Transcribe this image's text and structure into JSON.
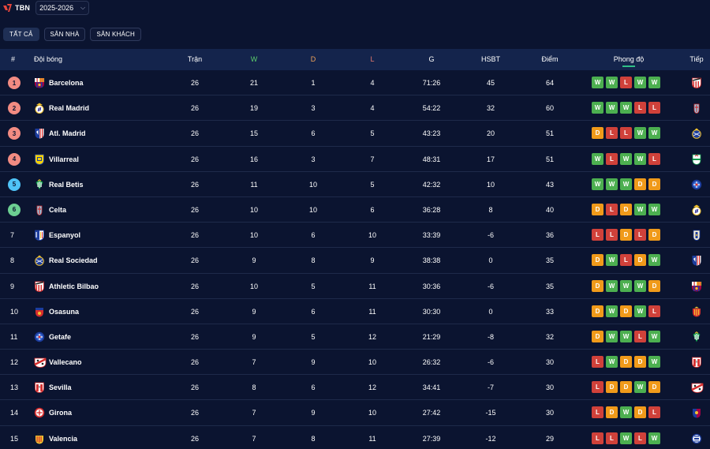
{
  "brand": {
    "logo_icon": "tbn-logo-icon",
    "name": "TBN",
    "color": "#e8463c"
  },
  "season": {
    "value": "2025-2026"
  },
  "filters": [
    {
      "label": "TẤT CẢ",
      "active": true
    },
    {
      "label": "SÂN NHÀ",
      "active": false
    },
    {
      "label": "SÂN KHÁCH",
      "active": false
    }
  ],
  "headers": {
    "rank": "#",
    "team": "Đội bóng",
    "played": "Trận",
    "won": "W",
    "drawn": "D",
    "lost": "L",
    "goals": "G",
    "goal_diff": "HSBT",
    "points": "Điểm",
    "form": "Phong độ",
    "next": "Tiếp"
  },
  "zone_colors": {
    "1": "#f28b82",
    "2": "#f28b82",
    "3": "#f28b82",
    "4": "#f28b82",
    "5": "#4fc3f7",
    "6": "#6ccf92"
  },
  "form_colors": {
    "W": "#4caf50",
    "D": "#f09a1a",
    "L": "#d0413a"
  },
  "rows": [
    {
      "rank": "1",
      "zone": "1",
      "team": "Barcelona",
      "crest": "barcelona-crest-icon",
      "played": "26",
      "won": "21",
      "drawn": "1",
      "lost": "4",
      "goals": "71:26",
      "goal_diff": "45",
      "points": "64",
      "form": [
        "W",
        "W",
        "L",
        "W",
        "W"
      ],
      "next": "athletic-bilbao-crest-icon"
    },
    {
      "rank": "2",
      "zone": "2",
      "team": "Real Madrid",
      "crest": "real-madrid-crest-icon",
      "played": "26",
      "won": "19",
      "drawn": "3",
      "lost": "4",
      "goals": "54:22",
      "goal_diff": "32",
      "points": "60",
      "form": [
        "W",
        "W",
        "W",
        "L",
        "L"
      ],
      "next": "celta-crest-icon"
    },
    {
      "rank": "3",
      "zone": "3",
      "team": "Atl. Madrid",
      "crest": "atletico-madrid-crest-icon",
      "played": "26",
      "won": "15",
      "drawn": "6",
      "lost": "5",
      "goals": "43:23",
      "goal_diff": "20",
      "points": "51",
      "form": [
        "D",
        "L",
        "L",
        "W",
        "W"
      ],
      "next": "real-sociedad-crest-icon"
    },
    {
      "rank": "4",
      "zone": "4",
      "team": "Villarreal",
      "crest": "villarreal-crest-icon",
      "played": "26",
      "won": "16",
      "drawn": "3",
      "lost": "7",
      "goals": "48:31",
      "goal_diff": "17",
      "points": "51",
      "form": [
        "W",
        "L",
        "W",
        "W",
        "L"
      ],
      "next": "elche-crest-icon"
    },
    {
      "rank": "5",
      "zone": "5",
      "team": "Real Betis",
      "crest": "real-betis-crest-icon",
      "played": "26",
      "won": "11",
      "drawn": "10",
      "lost": "5",
      "goals": "42:32",
      "goal_diff": "10",
      "points": "43",
      "form": [
        "W",
        "W",
        "W",
        "D",
        "D"
      ],
      "next": "getafe-crest-icon"
    },
    {
      "rank": "6",
      "zone": "6",
      "team": "Celta",
      "crest": "celta-crest-icon",
      "played": "26",
      "won": "10",
      "drawn": "10",
      "lost": "6",
      "goals": "36:28",
      "goal_diff": "8",
      "points": "40",
      "form": [
        "D",
        "L",
        "D",
        "W",
        "W"
      ],
      "next": "real-madrid-crest-icon"
    },
    {
      "rank": "7",
      "zone": "",
      "team": "Espanyol",
      "crest": "espanyol-crest-icon",
      "played": "26",
      "won": "10",
      "drawn": "6",
      "lost": "10",
      "goals": "33:39",
      "goal_diff": "-6",
      "points": "36",
      "form": [
        "L",
        "L",
        "D",
        "L",
        "D"
      ],
      "next": "oviedo-crest-icon"
    },
    {
      "rank": "8",
      "zone": "",
      "team": "Real Sociedad",
      "crest": "real-sociedad-crest-icon",
      "played": "26",
      "won": "9",
      "drawn": "8",
      "lost": "9",
      "goals": "38:38",
      "goal_diff": "0",
      "points": "35",
      "form": [
        "D",
        "W",
        "L",
        "D",
        "W"
      ],
      "next": "atletico-madrid-crest-icon"
    },
    {
      "rank": "9",
      "zone": "",
      "team": "Athletic Bilbao",
      "crest": "athletic-bilbao-crest-icon",
      "played": "26",
      "won": "10",
      "drawn": "5",
      "lost": "11",
      "goals": "30:36",
      "goal_diff": "-6",
      "points": "35",
      "form": [
        "D",
        "W",
        "W",
        "W",
        "D"
      ],
      "next": "barcelona-crest-icon"
    },
    {
      "rank": "10",
      "zone": "",
      "team": "Osasuna",
      "crest": "osasuna-crest-icon",
      "played": "26",
      "won": "9",
      "drawn": "6",
      "lost": "11",
      "goals": "30:30",
      "goal_diff": "0",
      "points": "33",
      "form": [
        "D",
        "W",
        "D",
        "W",
        "L"
      ],
      "next": "mallorca-crest-icon"
    },
    {
      "rank": "11",
      "zone": "",
      "team": "Getafe",
      "crest": "getafe-crest-icon",
      "played": "26",
      "won": "9",
      "drawn": "5",
      "lost": "12",
      "goals": "21:29",
      "goal_diff": "-8",
      "points": "32",
      "form": [
        "D",
        "W",
        "W",
        "L",
        "W"
      ],
      "next": "real-betis-crest-icon"
    },
    {
      "rank": "12",
      "zone": "",
      "team": "Vallecano",
      "crest": "vallecano-crest-icon",
      "played": "26",
      "won": "7",
      "drawn": "9",
      "lost": "10",
      "goals": "26:32",
      "goal_diff": "-6",
      "points": "30",
      "form": [
        "L",
        "W",
        "D",
        "D",
        "W"
      ],
      "next": "sevilla-crest-icon"
    },
    {
      "rank": "13",
      "zone": "",
      "team": "Sevilla",
      "crest": "sevilla-crest-icon",
      "played": "26",
      "won": "8",
      "drawn": "6",
      "lost": "12",
      "goals": "34:41",
      "goal_diff": "-7",
      "points": "30",
      "form": [
        "L",
        "D",
        "D",
        "W",
        "D"
      ],
      "next": "vallecano-crest-icon"
    },
    {
      "rank": "14",
      "zone": "",
      "team": "Girona",
      "crest": "girona-crest-icon",
      "played": "26",
      "won": "7",
      "drawn": "9",
      "lost": "10",
      "goals": "27:42",
      "goal_diff": "-15",
      "points": "30",
      "form": [
        "L",
        "D",
        "W",
        "D",
        "L"
      ],
      "next": "levante-crest-icon"
    },
    {
      "rank": "15",
      "zone": "",
      "team": "Valencia",
      "crest": "valencia-crest-icon",
      "played": "26",
      "won": "7",
      "drawn": "8",
      "lost": "11",
      "goals": "27:39",
      "goal_diff": "-12",
      "points": "29",
      "form": [
        "L",
        "L",
        "W",
        "L",
        "W"
      ],
      "next": "alaves-crest-icon"
    }
  ]
}
